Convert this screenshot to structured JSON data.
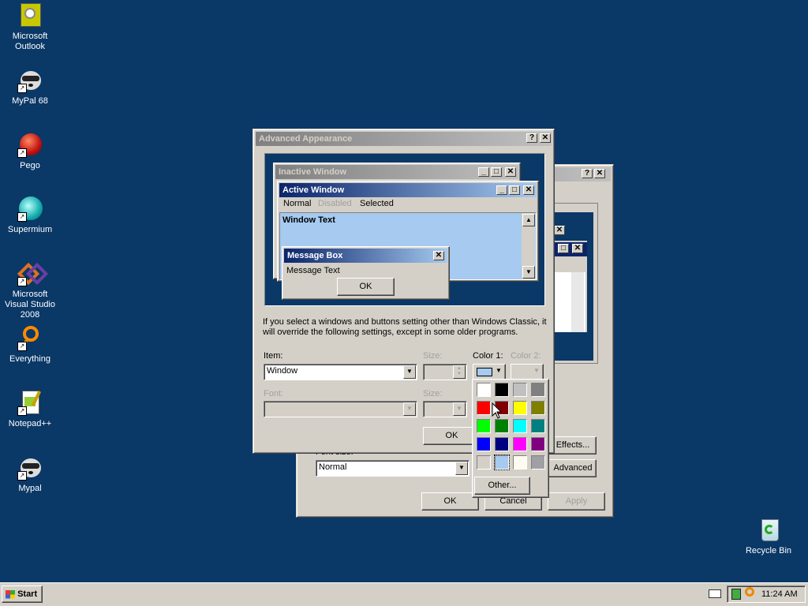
{
  "desktop": {
    "icons": [
      {
        "label": "Microsoft Outlook",
        "icon": "outlook-icon"
      },
      {
        "label": "MyPal 68",
        "icon": "raccoon-icon"
      },
      {
        "label": "Pego",
        "icon": "pego-icon"
      },
      {
        "label": "Supermium",
        "icon": "supermium-icon"
      },
      {
        "label": "Microsoft Visual Studio 2008",
        "icon": "visual-studio-icon"
      },
      {
        "label": "Everything",
        "icon": "everything-icon"
      },
      {
        "label": "Notepad++",
        "icon": "notepadpp-icon"
      },
      {
        "label": "Mypal",
        "icon": "raccoon-icon"
      },
      {
        "label": "Recycle Bin",
        "icon": "recycle-bin-icon"
      }
    ],
    "background_color": "#0a3867"
  },
  "back_dialog": {
    "font_size_label": "Font size:",
    "font_size_value": "Normal",
    "effects_label": "Effects...",
    "advanced_label": "Advanced",
    "ok_label": "OK",
    "cancel_label": "Cancel",
    "apply_label": "Apply"
  },
  "advanced": {
    "title": "Advanced Appearance",
    "preview": {
      "inactive_title": "Inactive Window",
      "active_title": "Active Window",
      "menu_normal": "Normal",
      "menu_disabled": "Disabled",
      "menu_selected": "Selected",
      "window_text": "Window Text",
      "msgbox_title": "Message Box",
      "msgbox_text": "Message Text",
      "msgbox_ok": "OK"
    },
    "info_text": "If you select a windows and buttons setting other than Windows Classic, it will override the following settings, except in some older programs.",
    "item_label": "Item:",
    "item_value": "Window",
    "size_label": "Size:",
    "color1_label": "Color 1:",
    "color2_label": "Color 2:",
    "font_label": "Font:",
    "font_size_label": "Size:",
    "ok_label": "OK"
  },
  "palette": {
    "colors": [
      "#ffffff",
      "#000000",
      "#c0c0c0",
      "#808080",
      "#ff0000",
      "#800000",
      "#ffff00",
      "#808000",
      "#00ff00",
      "#008000",
      "#00ffff",
      "#008080",
      "#0000ff",
      "#000080",
      "#ff00ff",
      "#800080",
      "#d4d0c8",
      "#a6caf0",
      "#fffbf0",
      "#a0a0a4"
    ],
    "selected_color": "#a6caf0",
    "other_label": "Other..."
  },
  "taskbar": {
    "start_label": "Start",
    "clock": "11:24 AM"
  }
}
